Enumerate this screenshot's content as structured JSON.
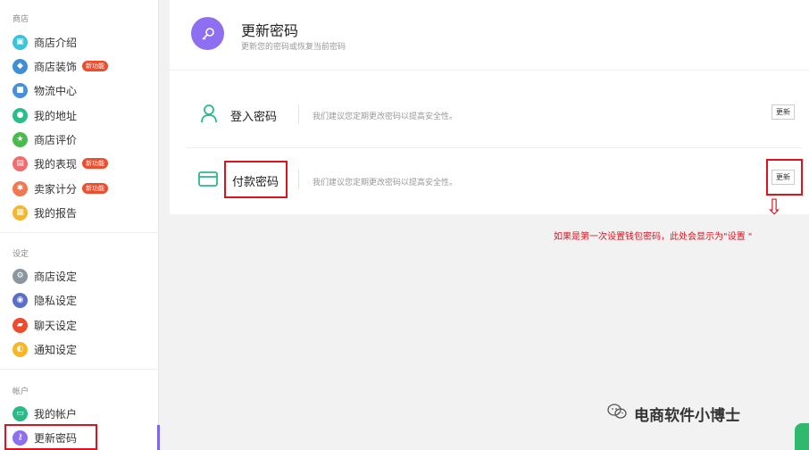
{
  "sidebar": {
    "sections": [
      {
        "title": "商店"
      },
      {
        "title": "设定"
      },
      {
        "title": "帐户"
      }
    ],
    "items": [
      {
        "label": "商店介绍",
        "color": "#3fc1d8"
      },
      {
        "label": "商店装饰",
        "color": "#3f8ed8",
        "badge": "新功能"
      },
      {
        "label": "物流中心",
        "color": "#4a8fd9"
      },
      {
        "label": "我的地址",
        "color": "#2bbd8a"
      },
      {
        "label": "商店评价",
        "color": "#4cbb4f"
      },
      {
        "label": "我的表现",
        "color": "#f06d6d",
        "badge": "新功能"
      },
      {
        "label": "卖家计分",
        "color": "#f27852",
        "badge": "新功能"
      },
      {
        "label": "我的报告",
        "color": "#f4b72b"
      },
      {
        "label": "商店设定",
        "color": "#8c96a0"
      },
      {
        "label": "隐私设定",
        "color": "#5b6fc7"
      },
      {
        "label": "聊天设定",
        "color": "#ee4d2d"
      },
      {
        "label": "通知设定",
        "color": "#f4b72b"
      },
      {
        "label": "我的帐户",
        "color": "#2bb98a"
      },
      {
        "label": "更新密码",
        "color": "#8e6ff2"
      }
    ]
  },
  "header": {
    "title": "更新密码",
    "subtitle": "更新您的密码或恢复当前密码"
  },
  "rows": [
    {
      "label": "登入密码",
      "desc": "我们建议您定期更改密码以提高安全性。",
      "button": "更新",
      "icon_color": "#2bb98a"
    },
    {
      "label": "付款密码",
      "desc": "我们建议您定期更改密码以提高安全性。",
      "button": "更新",
      "icon_color": "#2bb98a"
    }
  ],
  "annotation": {
    "arrow": "⇩",
    "text": "如果是第一次设置钱包密码，此处会显示为\"设置  \""
  },
  "watermark": {
    "text": "电商软件小博士"
  },
  "colors": {
    "accent": "#8e6ff2",
    "highlight": "#e0121e"
  }
}
